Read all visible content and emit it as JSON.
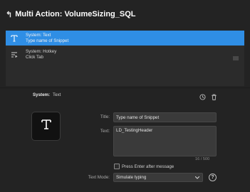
{
  "header": {
    "back_glyph": "↰",
    "title": "Multi Action: VolumeSizing_SQL"
  },
  "actions": [
    {
      "line1": "System: Text",
      "line2": "Type name of Snippet",
      "icon": "text-tool-icon",
      "selected": true
    },
    {
      "line1": "System: Hotkey",
      "line2": "Click Tab",
      "icon": "hotkey-icon",
      "selected": false
    }
  ],
  "panel": {
    "system_label": "System:",
    "system_value": "Text",
    "icons": [
      "history-icon",
      "trash-icon"
    ],
    "big_icon": "text-tool-icon"
  },
  "form": {
    "title_label": "Title:",
    "title_value": "Type name of Snippet",
    "text_label": "Text:",
    "text_value": "LD_TestingHeader",
    "counter": "16 / 500",
    "checkbox_label": "Press Enter after message",
    "checkbox_checked": false,
    "text_mode_label": "Text Mode:",
    "text_mode_value": "Simulate typing",
    "help_glyph": "?"
  },
  "colors": {
    "background": "#232323",
    "selected": "#2f8ee5",
    "input": "#3a3a3a"
  }
}
